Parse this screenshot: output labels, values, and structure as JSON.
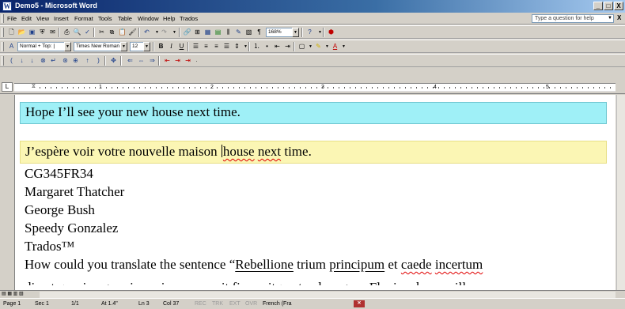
{
  "window": {
    "title": "Demo5 - Microsoft Word",
    "app_icon": "word-icon",
    "controls": [
      "_",
      "□",
      "X"
    ]
  },
  "menu": {
    "items": [
      "File",
      "Edit",
      "View",
      "Insert",
      "Format",
      "Tools",
      "Table",
      "Window",
      "Help",
      "Trados"
    ],
    "question_placeholder": "Type a question for help",
    "close_doc": "X"
  },
  "standard_toolbar": {
    "zoom": "168%",
    "icons": [
      "new-icon",
      "open-icon",
      "save-icon",
      "permission-icon",
      "email-icon",
      "print-icon",
      "print-preview-icon",
      "spelling-icon",
      "cut-icon",
      "copy-icon",
      "paste-icon",
      "format-painter-icon",
      "undo-icon",
      "redo-icon",
      "hyperlink-icon",
      "tables-borders-icon",
      "insert-table-icon",
      "insert-excel-icon",
      "columns-icon",
      "drawing-icon",
      "document-map-icon",
      "show-hide-icon",
      "help-icon",
      "translate-icon"
    ]
  },
  "formatting_toolbar": {
    "style": "Normal + Top: |",
    "font": "Times New Roman",
    "size": "12",
    "bold": "B",
    "italic": "I",
    "underline": "U"
  },
  "trados_toolbar": {
    "icons": [
      "open-get-icon",
      "get-next-icon",
      "restore-icon",
      "set-close-icon",
      "close-next-icon",
      "get-concordance-icon",
      "translate-to-fuzzy-icon",
      "copy-source-icon",
      "clear-target-icon",
      "close-segment-icon"
    ]
  },
  "ruler": {
    "numbers": [
      "1",
      "2",
      "3",
      "4",
      "5"
    ]
  },
  "document": {
    "source_segment": "Hope I’ll see your new house next time.",
    "target_segment_before_caret": "J’espère voir votre nouvelle maison ",
    "target_segment_after_caret_1": "house",
    "target_segment_after_caret_2": " ",
    "target_segment_after_caret_3": "next",
    "target_segment_after_caret_4": " time.",
    "lines": [
      "CG345FR34",
      "Margaret Thatcher",
      "George Bush",
      "Speedy Gonzalez",
      "Trados™"
    ],
    "long_line_1a": "How could you translate the sentence “",
    "long_line_1b": "Rebellione",
    "long_line_1c": " trium ",
    "long_line_1d": "principum",
    "long_line_1e": " et ",
    "long_line_1f": "caede",
    "long_line_1g": " ",
    "long_line_1h": "incertum",
    "long_line_2": "diu et quasi vagum imperium suscepit firmavitque tandem gens Flavia, obscura illa"
  },
  "status_bar": {
    "page": "Page 1",
    "section": "Sec 1",
    "pages": "1/1",
    "at": "At 1.4\"",
    "line": "Ln 3",
    "col": "Col 37",
    "rec": "REC",
    "trk": "TRK",
    "ext": "EXT",
    "ovr": "OVR",
    "language": "French (Fra",
    "book_icon": "spelling-status-icon"
  },
  "colors": {
    "source_bg": "#9ff0f7",
    "target_bg": "#fbf6b4",
    "title_bar": "#0a246a"
  }
}
